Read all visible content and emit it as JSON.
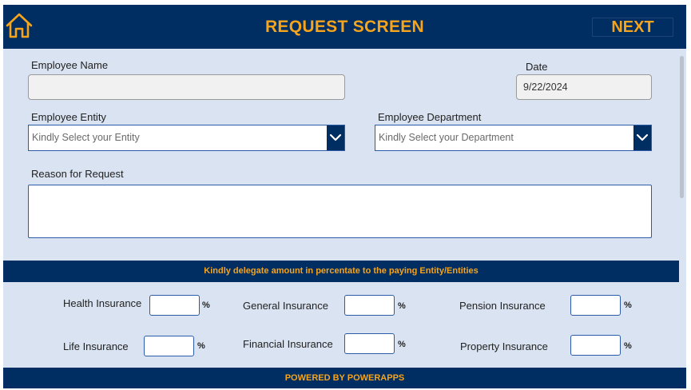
{
  "header": {
    "title": "REQUEST SCREEN",
    "next_label": "NEXT",
    "home_icon": "home-icon"
  },
  "form": {
    "employee_name": {
      "label": "Employee Name",
      "value": ""
    },
    "date": {
      "label": "Date",
      "value": "9/22/2024"
    },
    "entity": {
      "label": "Employee Entity",
      "placeholder": "Kindly Select your Entity",
      "icon": "chevron-down-icon"
    },
    "department": {
      "label": "Employee Department",
      "placeholder": "Kindly Select your Department",
      "icon": "chevron-down-icon"
    },
    "reason": {
      "label": "Reason for Request",
      "value": ""
    }
  },
  "allocation": {
    "banner": "Kindly delegate amount in percentate to the paying Entity/Entities",
    "percent_symbol": "%",
    "items": [
      {
        "label": "Health Insurance",
        "value": ""
      },
      {
        "label": "General Insurance",
        "value": ""
      },
      {
        "label": "Pension Insurance",
        "value": ""
      },
      {
        "label": "Life Insurance",
        "value": ""
      },
      {
        "label": "Financial Insurance",
        "value": ""
      },
      {
        "label": "Property Insurance",
        "value": ""
      }
    ]
  },
  "footer": {
    "text": "POWERED BY POWERAPPS"
  },
  "colors": {
    "primary": "#002d62",
    "accent": "#f5a41b",
    "background": "#d9e3f1",
    "input_border": "#2c5ba7"
  }
}
